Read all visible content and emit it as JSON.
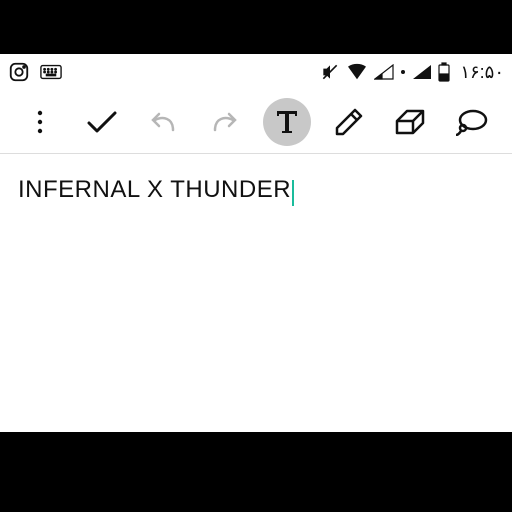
{
  "status": {
    "time": "۱۶:۵۰"
  },
  "editor": {
    "text": "INFERNAL X THUNDER"
  }
}
